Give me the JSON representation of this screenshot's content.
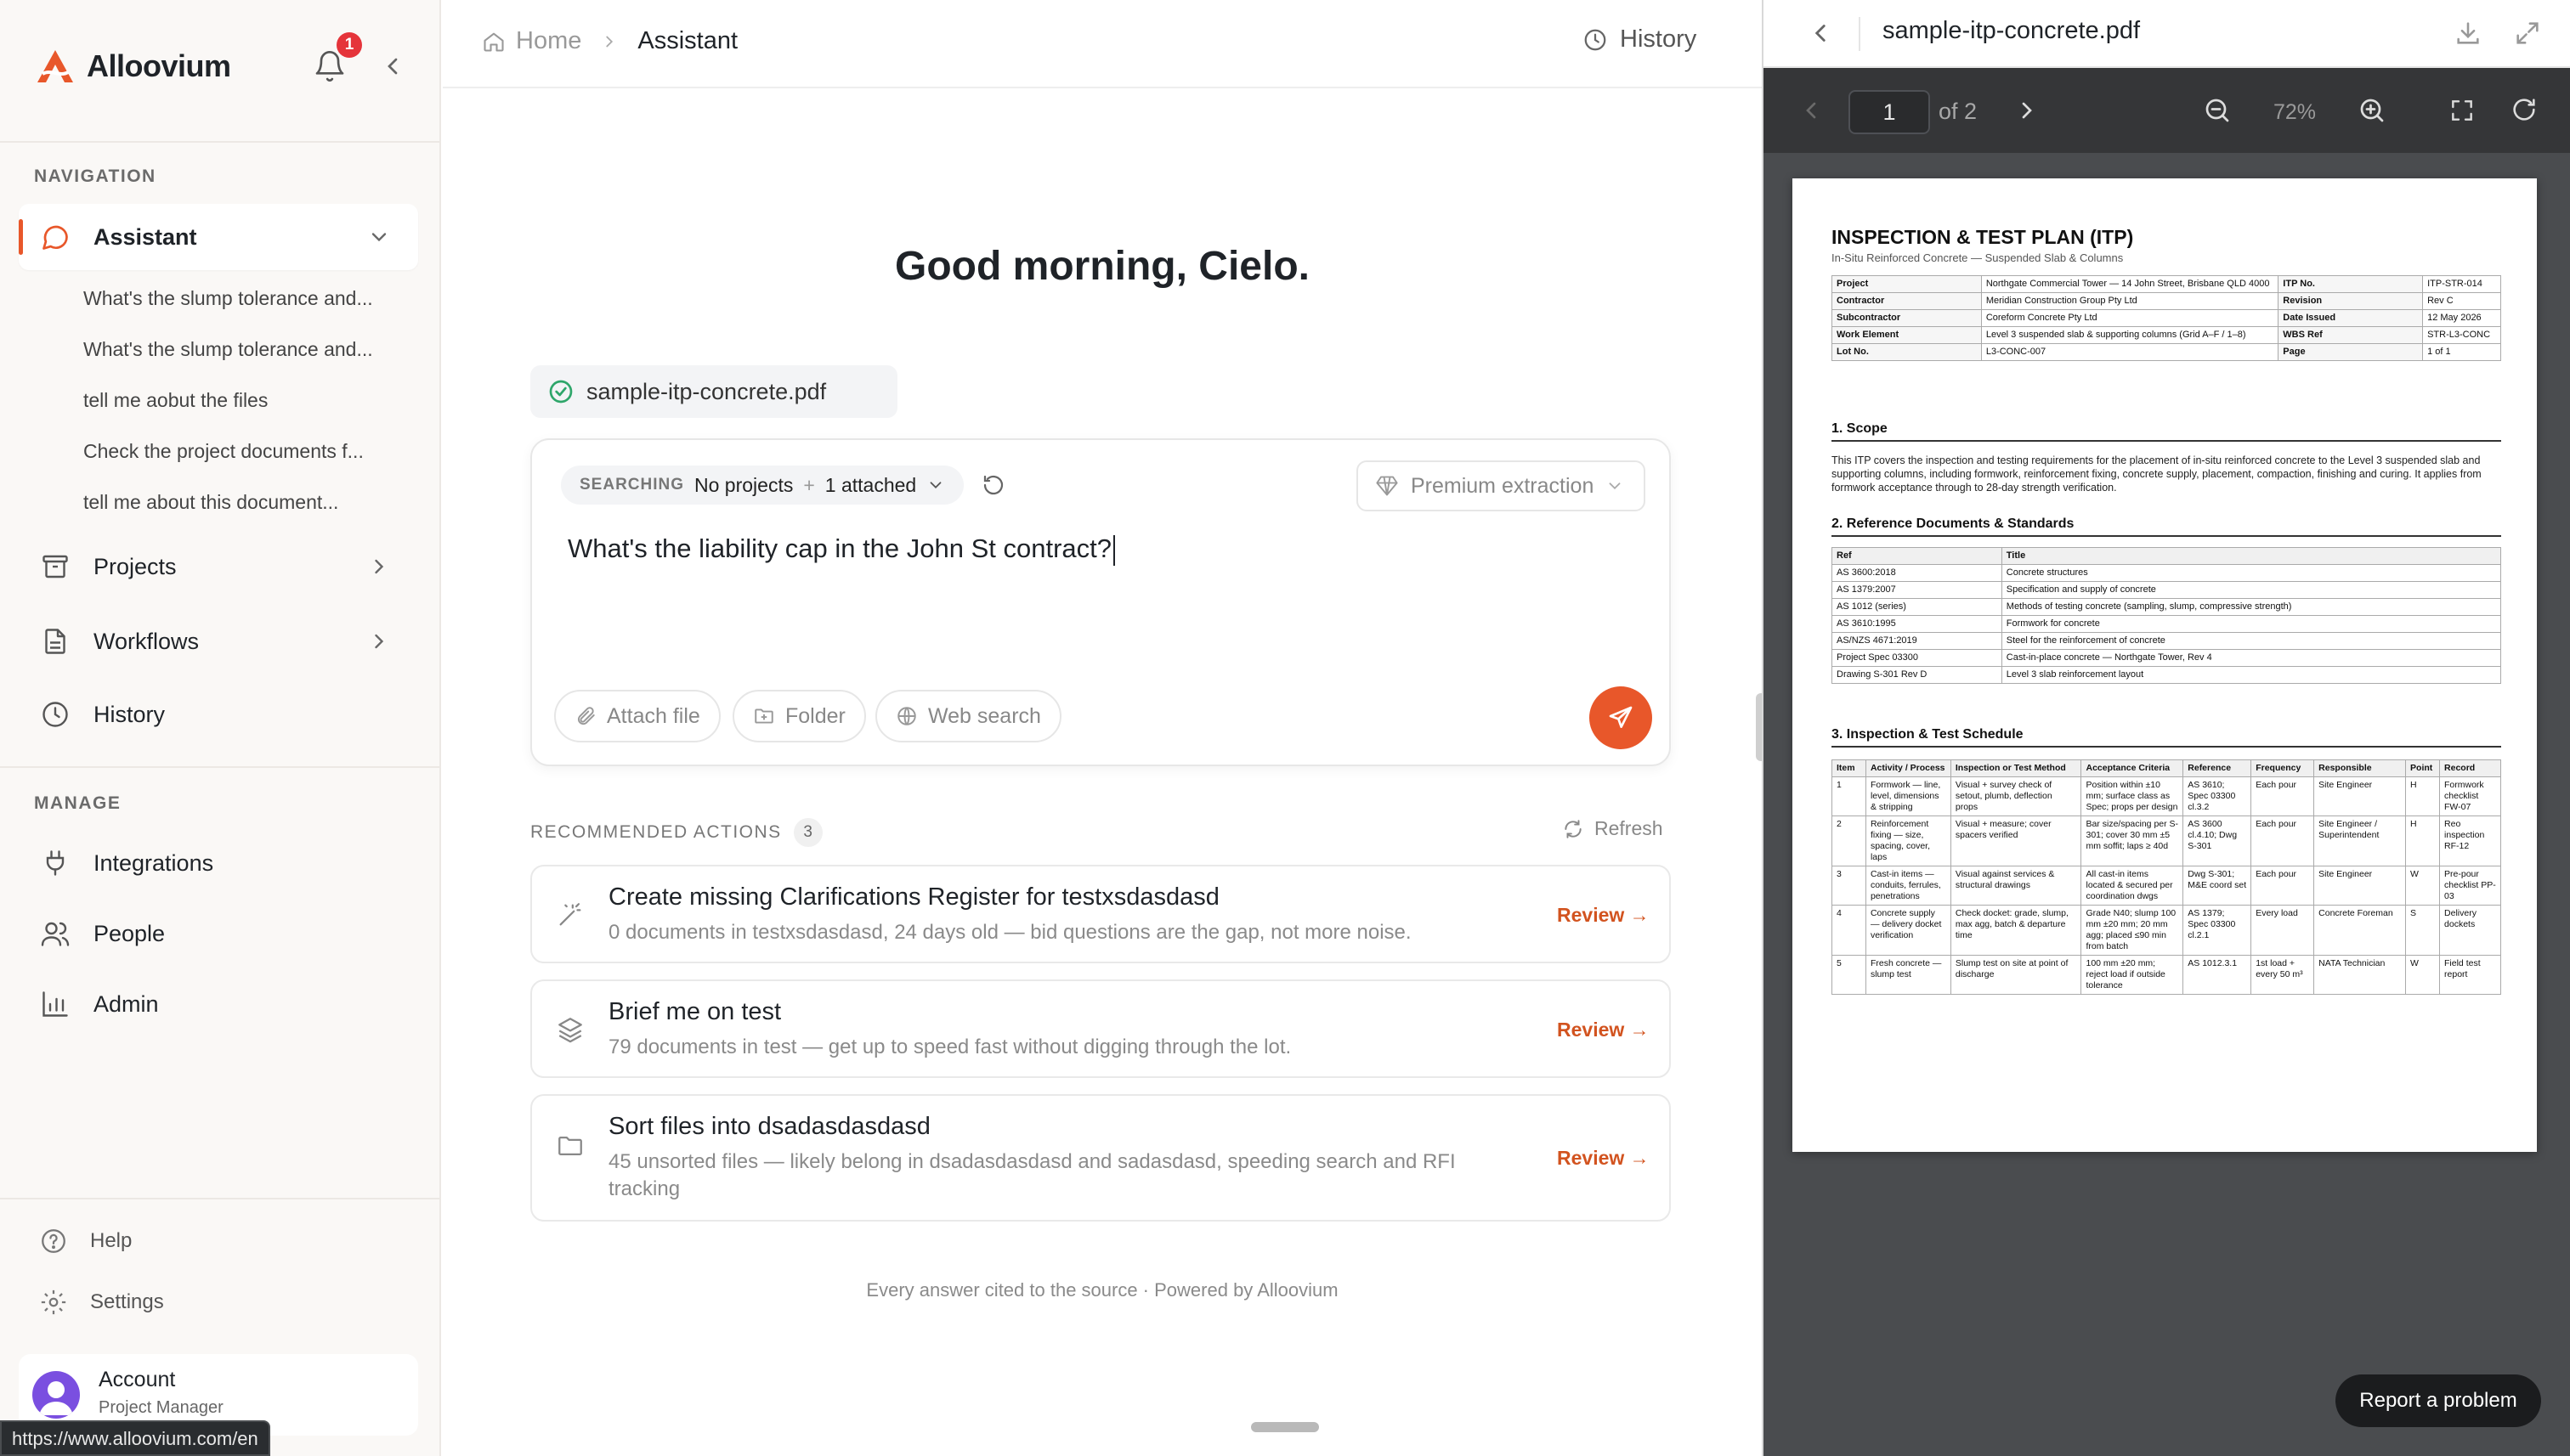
{
  "brand": {
    "name": "Alloovium"
  },
  "notifications": {
    "count": "1"
  },
  "sidebar": {
    "nav_label": "NAVIGATION",
    "manage_label": "MANAGE",
    "active": "Assistant",
    "items": [
      {
        "label": "Assistant"
      },
      {
        "label": "Projects"
      },
      {
        "label": "Workflows"
      },
      {
        "label": "History"
      }
    ],
    "recent_chats": [
      "What's the slump tolerance and...",
      "What's the slump tolerance and...",
      "tell me aobut the files",
      "Check the project documents f...",
      "tell me about this document..."
    ],
    "manage_items": [
      {
        "label": "Integrations"
      },
      {
        "label": "People"
      },
      {
        "label": "Admin"
      }
    ],
    "bottom_items": [
      {
        "label": "Help"
      },
      {
        "label": "Settings"
      }
    ],
    "account": {
      "name": "Account",
      "role": "Project Manager"
    }
  },
  "status_bar": {
    "url": "https://www.alloovium.com/en"
  },
  "header": {
    "breadcrumb": [
      "Home",
      "Assistant"
    ],
    "history_label": "History"
  },
  "main": {
    "greeting": "Good morning, Cielo.",
    "attached_file": "sample-itp-concrete.pdf",
    "composer": {
      "searching_label": "SEARCHING",
      "project_scope": "No projects",
      "separator": "+",
      "attached_count": "1 attached",
      "extraction_mode": "Premium extraction",
      "query": "What's the liability cap in the John St contract?",
      "tools": [
        "Attach file",
        "Folder",
        "Web search"
      ]
    },
    "recommended": {
      "label": "RECOMMENDED ACTIONS",
      "count": "3",
      "refresh_label": "Refresh",
      "review_label": "Review →",
      "items": [
        {
          "title": "Create missing Clarifications Register for testxsdasdasd",
          "desc": "0 documents in testxsdasdasd, 24 days old — bid questions are the gap, not more noise.",
          "icon": "magic-wand-icon"
        },
        {
          "title": "Brief me on test",
          "desc": "79 documents in test — get up to speed fast without digging through the lot.",
          "icon": "layers-icon"
        },
        {
          "title": "Sort files into dsadasdasdasd",
          "desc": "45 unsorted files — likely belong in dsadasdasdasd and sadasdasd, speeding search and RFI tracking",
          "icon": "folder-icon"
        }
      ]
    },
    "footer": "Every answer cited to the source · Powered by Alloovium"
  },
  "pdf": {
    "filename": "sample-itp-concrete.pdf",
    "page": "1",
    "of_pages": "of 2",
    "zoom": "72%",
    "doc": {
      "title": "INSPECTION & TEST PLAN (ITP)",
      "subtitle": "In-Situ Reinforced Concrete — Suspended Slab & Columns",
      "meta": [
        [
          "Project",
          "Northgate Commercial Tower — 14 John Street, Brisbane QLD 4000",
          "ITP No.",
          "ITP-STR-014"
        ],
        [
          "Contractor",
          "Meridian Construction Group Pty Ltd",
          "Revision",
          "Rev C"
        ],
        [
          "Subcontractor",
          "Coreform Concrete Pty Ltd",
          "Date Issued",
          "12 May 2026"
        ],
        [
          "Work Element",
          "Level 3 suspended slab & supporting columns (Grid A–F / 1–8)",
          "WBS Ref",
          "STR-L3-CONC"
        ],
        [
          "Lot No.",
          "L3-CONC-007",
          "Page",
          "1 of 1"
        ]
      ],
      "s1": "1. Scope",
      "scope_text": "This ITP covers the inspection and testing requirements for the placement of in-situ reinforced concrete to the Level 3 suspended slab and supporting columns, including formwork, reinforcement fixing, concrete supply, placement, compaction, finishing and curing. It applies from formwork acceptance through to 28-day strength verification.",
      "s2": "2. Reference Documents & Standards",
      "refs_head": [
        "Ref",
        "Title"
      ],
      "refs": [
        [
          "AS 3600:2018",
          "Concrete structures"
        ],
        [
          "AS 1379:2007",
          "Specification and supply of concrete"
        ],
        [
          "AS 1012 (series)",
          "Methods of testing concrete (sampling, slump, compressive strength)"
        ],
        [
          "AS 3610:1995",
          "Formwork for concrete"
        ],
        [
          "AS/NZS 4671:2019",
          "Steel for the reinforcement of concrete"
        ],
        [
          "Project Spec 03300",
          "Cast-in-place concrete — Northgate Tower, Rev 4"
        ],
        [
          "Drawing S-301 Rev D",
          "Level 3 slab reinforcement layout"
        ]
      ],
      "s3": "3. Inspection & Test Schedule",
      "sched_head": [
        "Item",
        "Activity / Process",
        "Inspection or Test Method",
        "Acceptance Criteria",
        "Reference",
        "Frequency",
        "Responsible",
        "Point",
        "Record"
      ],
      "sched": [
        [
          "1",
          "Formwork — line, level, dimensions & stripping",
          "Visual + survey check of setout, plumb, deflection props",
          "Position within ±10 mm; surface class as Spec; props per design",
          "AS 3610; Spec 03300 cl.3.2",
          "Each pour",
          "Site Engineer",
          "H",
          "Formwork checklist FW-07"
        ],
        [
          "2",
          "Reinforcement fixing — size, spacing, cover, laps",
          "Visual + measure; cover spacers verified",
          "Bar size/spacing per S-301; cover 30 mm ±5 mm soffit; laps ≥ 40d",
          "AS 3600 cl.4.10; Dwg S-301",
          "Each pour",
          "Site Engineer / Superintendent",
          "H",
          "Reo inspection RF-12"
        ],
        [
          "3",
          "Cast-in items — conduits, ferrules, penetrations",
          "Visual against services & structural drawings",
          "All cast-in items located & secured per coordination dwgs",
          "Dwg S-301; M&E coord set",
          "Each pour",
          "Site Engineer",
          "W",
          "Pre-pour checklist PP-03"
        ],
        [
          "4",
          "Concrete supply — delivery docket verification",
          "Check docket: grade, slump, max agg, batch & departure time",
          "Grade N40; slump 100 mm ±20 mm; 20 mm agg; placed ≤90 min from batch",
          "AS 1379; Spec 03300 cl.2.1",
          "Every load",
          "Concrete Foreman",
          "S",
          "Delivery dockets"
        ],
        [
          "5",
          "Fresh concrete — slump test",
          "Slump test on site at point of discharge",
          "100 mm ±20 mm; reject load if outside tolerance",
          "AS 1012.3.1",
          "1st load + every 50 m³",
          "NATA Technician",
          "W",
          "Field test report"
        ]
      ]
    }
  },
  "report_button": "Report a problem",
  "colors": {
    "accent": "#e8572a",
    "badge": "#e5343a",
    "success": "#2ea66a"
  }
}
